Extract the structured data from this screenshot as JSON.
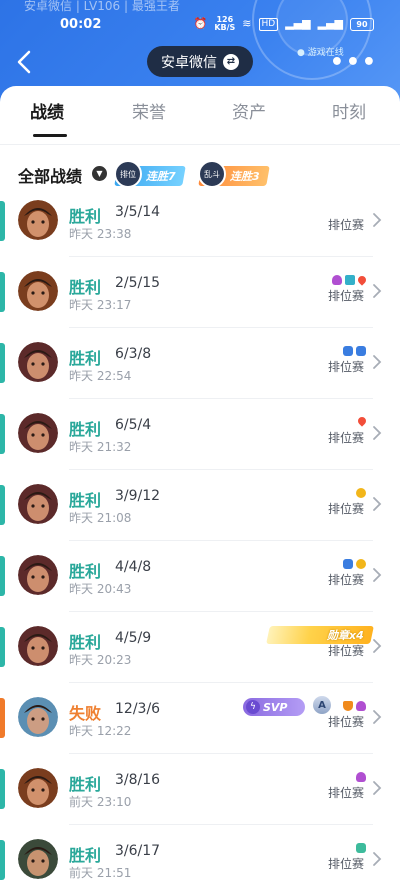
{
  "header": {
    "subtitle": "安卓微信 | LV106 | 最强王者",
    "time": "00:02",
    "speed_value": "126",
    "speed_unit": "KB/S",
    "network": "HD",
    "battery": "90",
    "title": "安卓微信",
    "online_status": "● 游戏在线"
  },
  "tabs": [
    {
      "label": "战绩",
      "active": true
    },
    {
      "label": "荣誉",
      "active": false
    },
    {
      "label": "资产",
      "active": false
    },
    {
      "label": "时刻",
      "active": false
    }
  ],
  "filter": {
    "title": "全部战绩",
    "streaks": [
      {
        "mascot": "排位",
        "label": "连胜7"
      },
      {
        "mascot": "乱斗",
        "label": "连胜3"
      }
    ]
  },
  "matches": [
    {
      "result": "胜利",
      "outcome": "win",
      "kda": "3/5/14",
      "time": "昨天 23:38",
      "mode": "排位赛",
      "badges": [],
      "hero_color": "#7a3d1e"
    },
    {
      "result": "胜利",
      "outcome": "win",
      "kda": "2/5/15",
      "time": "昨天 23:17",
      "mode": "排位赛",
      "badges": [
        "purple",
        "teal",
        "red"
      ],
      "hero_color": "#7a3d1e"
    },
    {
      "result": "胜利",
      "outcome": "win",
      "kda": "6/3/8",
      "time": "昨天 22:54",
      "mode": "排位赛",
      "badges": [
        "blue",
        "blue"
      ],
      "hero_color": "#5c2a2a"
    },
    {
      "result": "胜利",
      "outcome": "win",
      "kda": "6/5/4",
      "time": "昨天 21:32",
      "mode": "排位赛",
      "badges": [
        "red"
      ],
      "hero_color": "#5c2a2a"
    },
    {
      "result": "胜利",
      "outcome": "win",
      "kda": "3/9/12",
      "time": "昨天 21:08",
      "mode": "排位赛",
      "badges": [
        "gold"
      ],
      "hero_color": "#5c2a2a"
    },
    {
      "result": "胜利",
      "outcome": "win",
      "kda": "4/4/8",
      "time": "昨天 20:43",
      "mode": "排位赛",
      "badges": [
        "blue",
        "gold"
      ],
      "hero_color": "#5c2a2a"
    },
    {
      "result": "胜利",
      "outcome": "win",
      "kda": "4/5/9",
      "time": "昨天 20:23",
      "mode": "排位赛",
      "badges": [],
      "medal": "勋章x4",
      "hero_color": "#5c2a2a"
    },
    {
      "result": "失败",
      "outcome": "lose",
      "kda": "12/3/6",
      "time": "昨天 12:22",
      "mode": "排位赛",
      "badges": [
        "orange",
        "purple"
      ],
      "svp": "SVP",
      "rank": "A",
      "hero_color": "#5b8fb3"
    },
    {
      "result": "胜利",
      "outcome": "win",
      "kda": "3/8/16",
      "time": "前天 23:10",
      "mode": "排位赛",
      "badges": [
        "purple"
      ],
      "hero_color": "#7a3d1e"
    },
    {
      "result": "胜利",
      "outcome": "win",
      "kda": "3/6/17",
      "time": "前天 21:51",
      "mode": "排位赛",
      "badges": [
        "green"
      ],
      "hero_color": "#3b4a3a"
    }
  ]
}
